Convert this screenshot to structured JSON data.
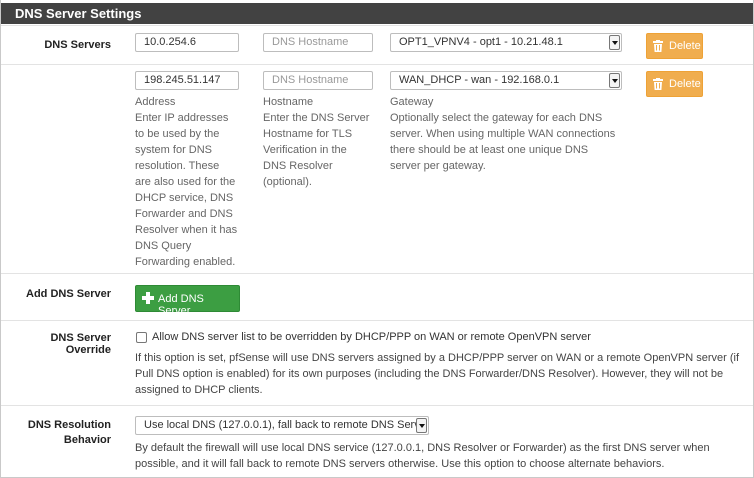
{
  "panel": {
    "title": "DNS Server Settings"
  },
  "dns_servers": {
    "label": "DNS Servers",
    "rows": [
      {
        "address": "10.0.254.6",
        "hostname_placeholder": "DNS Hostname",
        "gateway": "OPT1_VPNV4 - opt1 - 10.21.48.1",
        "delete_label": "Delete"
      },
      {
        "address": "198.245.51.147",
        "hostname_placeholder": "DNS Hostname",
        "gateway": "WAN_DHCP - wan - 192.168.0.1",
        "delete_label": "Delete"
      }
    ],
    "help": {
      "address_title": "Address",
      "address_text": [
        "Enter IP addresses",
        "to be used by the",
        "system for DNS",
        "resolution. These",
        "are also used for the",
        "DHCP service, DNS",
        "Forwarder and DNS",
        "Resolver when it has",
        "DNS Query",
        "Forwarding enabled."
      ],
      "hostname_title": "Hostname",
      "hostname_text": [
        "Enter the DNS Server",
        "Hostname for TLS",
        "Verification in the",
        "DNS Resolver",
        "(optional)."
      ],
      "gateway_title": "Gateway",
      "gateway_text": [
        "Optionally select the gateway for each DNS",
        "server. When using multiple WAN connections",
        "there should be at least one unique DNS",
        "server per gateway."
      ]
    }
  },
  "add_dns_server": {
    "label": "Add DNS Server",
    "button_label": "Add DNS Server"
  },
  "override": {
    "label": "DNS Server Override",
    "checkbox_label": "Allow DNS server list to be overridden by DHCP/PPP on WAN or remote OpenVPN server",
    "checked": false,
    "help": [
      "If this option is set, pfSense will use DNS servers assigned by a DHCP/PPP server on WAN or a remote OpenVPN server (if",
      "Pull DNS option is enabled) for its own purposes (including the DNS Forwarder/DNS Resolver). However, they will not be",
      "assigned to DHCP clients."
    ]
  },
  "resolution": {
    "label_line1": "DNS Resolution",
    "label_line2": "Behavior",
    "selected": "Use local DNS (127.0.0.1), fall back to remote DNS Serv",
    "help": [
      "By default the firewall will use local DNS service (127.0.0.1, DNS Resolver or Forwarder) as the first DNS server when",
      "possible, and it will fall back to remote DNS servers otherwise. Use this option to choose alternate behaviors."
    ]
  },
  "colors": {
    "heading_bg": "#424242",
    "delete_button": "#f0ad4e",
    "add_button": "#3c9e42"
  },
  "icons": {
    "delete": "trash-icon",
    "add": "plus-icon",
    "select": "chevron-down-icon"
  }
}
